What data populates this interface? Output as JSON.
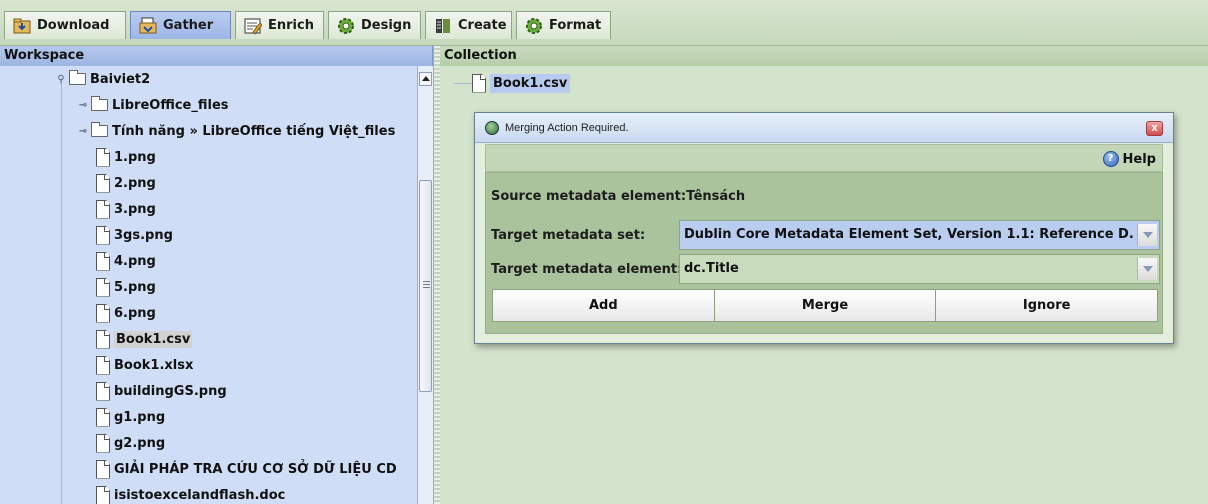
{
  "tabs": [
    {
      "label": "Download",
      "icon": "download-icon"
    },
    {
      "label": "Gather",
      "icon": "gather-icon",
      "active": true
    },
    {
      "label": "Enrich",
      "icon": "enrich-icon"
    },
    {
      "label": "Design",
      "icon": "design-gear-icon"
    },
    {
      "label": "Create",
      "icon": "create-icon"
    },
    {
      "label": "Format",
      "icon": "format-gear-icon"
    }
  ],
  "workspace": {
    "title": "Workspace",
    "items": [
      {
        "label": "Baiviet2",
        "type": "folder",
        "expanded": true
      },
      {
        "label": "LibreOffice_files",
        "type": "folder"
      },
      {
        "label": "Tính năng » LibreOffice tiếng Việt_files",
        "type": "folder"
      },
      {
        "label": "1.png",
        "type": "file"
      },
      {
        "label": "2.png",
        "type": "file"
      },
      {
        "label": "3.png",
        "type": "file"
      },
      {
        "label": "3gs.png",
        "type": "file"
      },
      {
        "label": "4.png",
        "type": "file"
      },
      {
        "label": "5.png",
        "type": "file"
      },
      {
        "label": "6.png",
        "type": "file"
      },
      {
        "label": "Book1.csv",
        "type": "file",
        "selected": true
      },
      {
        "label": "Book1.xlsx",
        "type": "file"
      },
      {
        "label": "buildingGS.png",
        "type": "file"
      },
      {
        "label": "g1.png",
        "type": "file"
      },
      {
        "label": "g2.png",
        "type": "file"
      },
      {
        "label": "GIẢI PHÁP TRA CỨU CƠ SỞ DỮ LIỆU CD",
        "type": "file"
      },
      {
        "label": "isistoexcelandflash.doc",
        "type": "file"
      }
    ]
  },
  "collection": {
    "title": "Collection",
    "item": "Book1.csv"
  },
  "dialog": {
    "title": "Merging Action Required.",
    "close_label": "x",
    "help_label": "Help",
    "source_label": "Source metadata element:",
    "source_value": "Tênsách",
    "target_set_label": "Target metadata set:",
    "target_set_value": "Dublin Core Metadata Element Set, Version 1.1: Reference D...",
    "target_element_label": "Target metadata element:",
    "target_element_value": "dc.Title",
    "buttons": {
      "add": "Add",
      "merge": "Merge",
      "ignore": "Ignore"
    }
  },
  "colors": {
    "background": "#d4e3cc",
    "workspace_bg": "#cfdef6",
    "active_tab": "#9db6e6",
    "selection": "#b9cdf0"
  }
}
